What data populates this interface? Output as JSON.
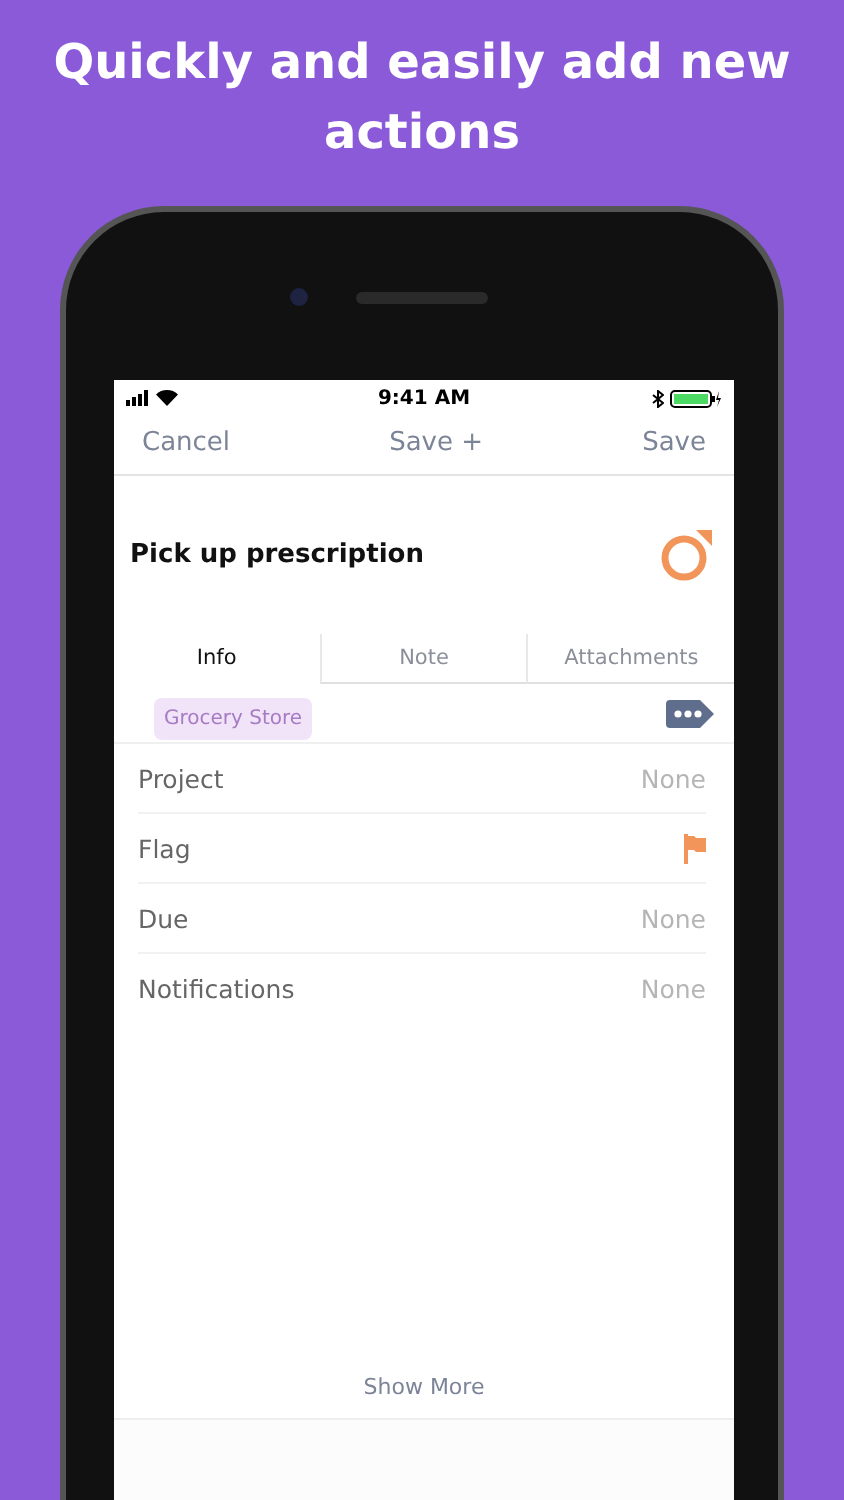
{
  "headline": "Quickly and easily add new actions",
  "status_bar": {
    "time": "9:41 AM"
  },
  "nav": {
    "cancel": "Cancel",
    "save_plus": "Save +",
    "save": "Save"
  },
  "task": {
    "title": "Pick up prescription"
  },
  "tabs": [
    {
      "label": "Info",
      "selected": true
    },
    {
      "label": "Note",
      "selected": false
    },
    {
      "label": "Attachments",
      "selected": false
    }
  ],
  "tags": [
    {
      "label": "Grocery Store"
    }
  ],
  "fields": [
    {
      "kind": "value",
      "label": "Project",
      "value": "None"
    },
    {
      "kind": "flag",
      "label": "Flag",
      "flagged": true
    },
    {
      "kind": "value",
      "label": "Due",
      "value": "None"
    },
    {
      "kind": "value",
      "label": "Notifications",
      "value": "None"
    }
  ],
  "show_more": "Show More"
}
